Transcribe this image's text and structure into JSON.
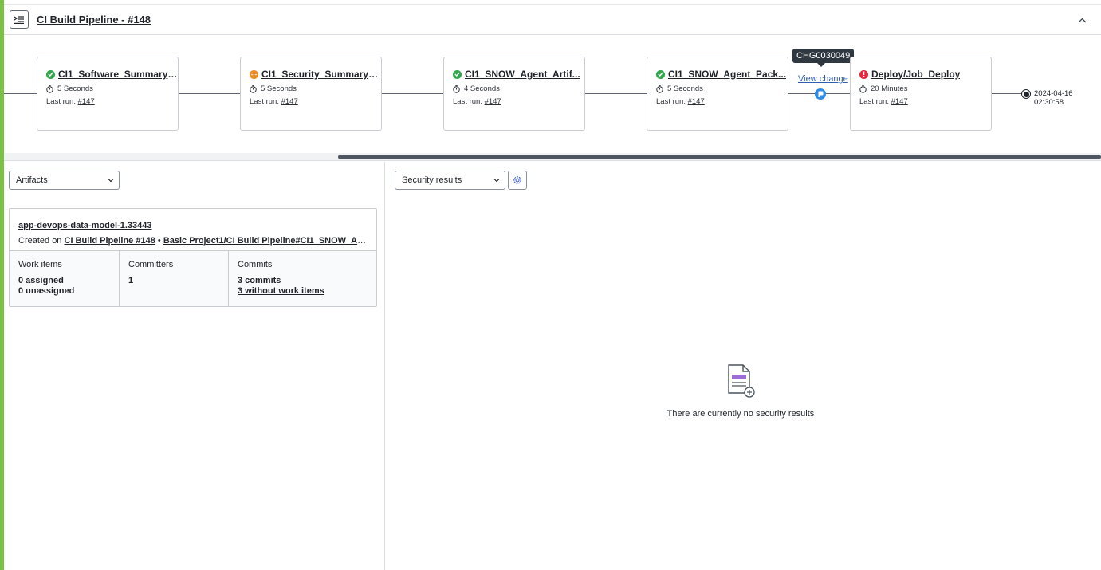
{
  "header": {
    "title": "CI Build Pipeline - #148"
  },
  "pipeline": {
    "stages": [
      {
        "name": "CI1_Software_Summary/...",
        "status": "success",
        "duration": "5 Seconds",
        "last_run_label": "Last run:",
        "last_run": "#147"
      },
      {
        "name": "CI1_Security_Summary_...",
        "status": "warning",
        "duration": "5 Seconds",
        "last_run_label": "Last run:",
        "last_run": "#147"
      },
      {
        "name": "CI1_SNOW_Agent_Artif...",
        "status": "success",
        "duration": "4 Seconds",
        "last_run_label": "Last run:",
        "last_run": "#147"
      },
      {
        "name": "CI1_SNOW_Agent_Pack...",
        "status": "success",
        "duration": "5 Seconds",
        "last_run_label": "Last run:",
        "last_run": "#147"
      },
      {
        "name": "Deploy/Job_Deploy",
        "status": "error",
        "duration": "20 Minutes",
        "last_run_label": "Last run:",
        "last_run": "#147"
      }
    ],
    "change": {
      "tooltip": "CHG0030049",
      "link": "View change"
    },
    "end": {
      "date": "2024-04-16",
      "time": "02:30:58"
    },
    "scroll_position": 0.31
  },
  "artifacts_panel": {
    "select_value": "Artifacts",
    "artifact": {
      "name": "app-devops-data-model-1.33443",
      "created_prefix": "Created on",
      "created_pipeline": "CI Build Pipeline #148",
      "separator": "•",
      "created_path": "Basic Project1/CI Build Pipeline#CI1_SNOW_Agent_..."
    },
    "metrics": [
      {
        "label": "Work items",
        "values": [
          "0 assigned",
          "0 unassigned"
        ]
      },
      {
        "label": "Committers",
        "values": [
          "1"
        ]
      },
      {
        "label": "Commits",
        "values": [
          "3 commits"
        ],
        "link": "3 without work items"
      }
    ]
  },
  "security_panel": {
    "select_value": "Security results",
    "empty_message": "There are currently no security results"
  },
  "colors": {
    "success": "#2ea84a",
    "warning": "#f08c1f",
    "error": "#e5283b",
    "accent": "#7cc242",
    "change_node": "#2f8be6",
    "empty_icon": "#9b6fd6"
  }
}
